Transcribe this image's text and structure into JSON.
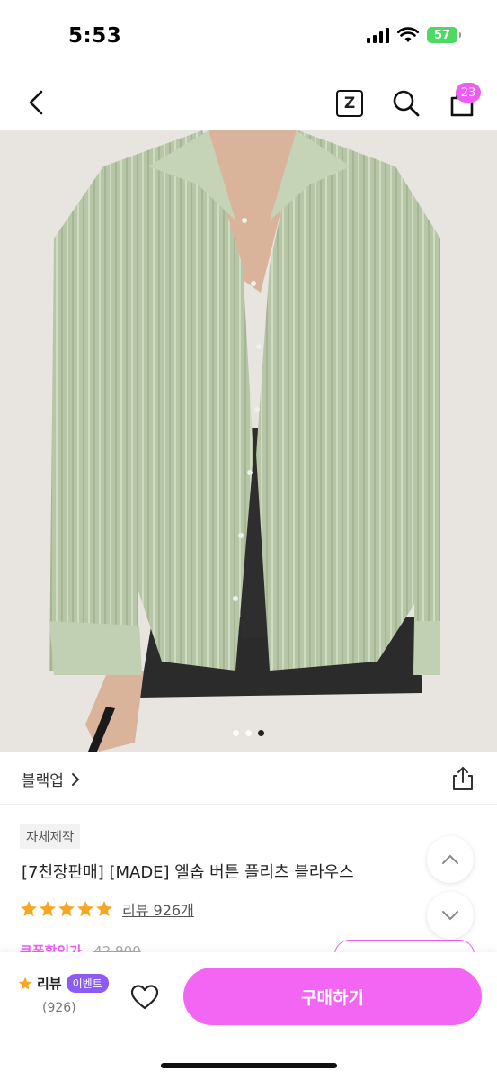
{
  "status_bar": {
    "time": "5:53",
    "battery": "57"
  },
  "nav": {
    "z_label": "Z",
    "cart_count": "23"
  },
  "gallery": {
    "pages": 3,
    "active_index": 2
  },
  "brand": {
    "name": "블랙업"
  },
  "product": {
    "tag": "자체제작",
    "title": "[7천장판매] [MADE] 엘솝 버튼 플리츠 블라우스",
    "rating": 5,
    "review_link": "리뷰 926개",
    "price_label": "쿠폰할인가",
    "price_original": "42,900"
  },
  "bottom_bar": {
    "review_label": "리뷰",
    "event_label": "이벤트",
    "review_count": "(926)",
    "buy_label": "구매하기"
  },
  "colors": {
    "accent": "#f366f3",
    "badge": "#ee5cf5",
    "event": "#8c5cf2",
    "star": "#f6a623"
  }
}
